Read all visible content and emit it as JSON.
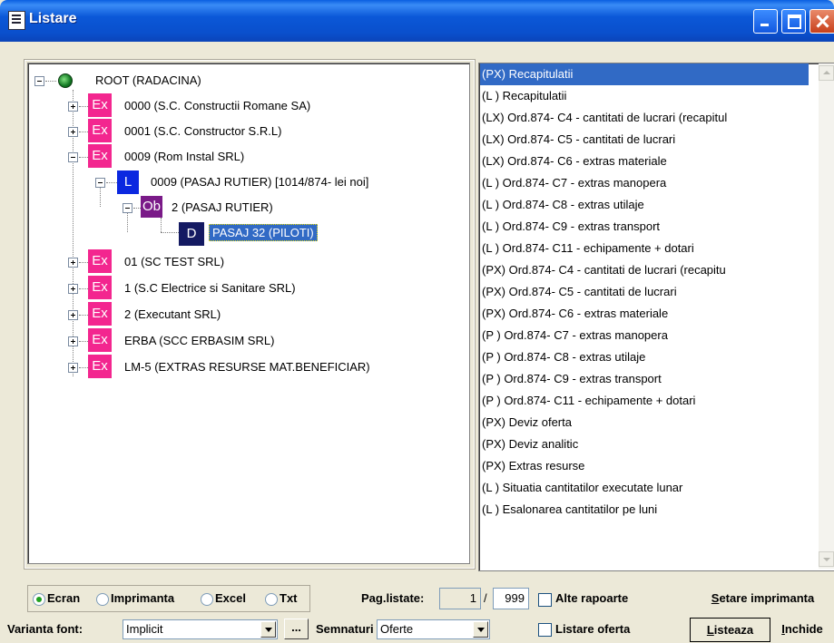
{
  "window": {
    "title": "Listare"
  },
  "tree": {
    "root": "ROOT (RADACINA)",
    "nodes": [
      {
        "badge": "Ex",
        "label": "0000 (S.C. Constructii Romane SA)"
      },
      {
        "badge": "Ex",
        "label": "0001 (S.C. Constructor S.R.L)"
      },
      {
        "badge": "Ex",
        "label": "0009 (Rom Instal SRL)"
      },
      {
        "badge": "L",
        "label": "0009 (PASAJ RUTIER) [1014/874- lei noi]"
      },
      {
        "badge": "Ob",
        "label": "2 (PASAJ RUTIER)"
      },
      {
        "badge": "D",
        "label": "PASAJ 32 (PILOTI)"
      },
      {
        "badge": "Ex",
        "label": "01 (SC TEST SRL)"
      },
      {
        "badge": "Ex",
        "label": "1 (S.C Electrice si Sanitare SRL)"
      },
      {
        "badge": "Ex",
        "label": "2 (Executant SRL)"
      },
      {
        "badge": "Ex",
        "label": "ERBA (SCC ERBASIM SRL)"
      },
      {
        "badge": "Ex",
        "label": "LM-5 (EXTRAS RESURSE MAT.BENEFICIAR)"
      }
    ],
    "colors": {
      "ex": "#f3268f",
      "l": "#0b28e0",
      "ob": "#7a1a88",
      "d": "#141a62",
      "selection": "#316ac5"
    }
  },
  "reports": {
    "items": [
      "(PX) Recapitulatii",
      "(L ) Recapitulatii",
      "(LX) Ord.874- C4 - cantitati de lucrari (recapitul",
      "(LX) Ord.874- C5 - cantitati de lucrari",
      "(LX) Ord.874- C6 - extras materiale",
      "(L ) Ord.874- C7 - extras manopera",
      "(L ) Ord.874- C8 - extras utilaje",
      "(L ) Ord.874- C9 - extras transport",
      "(L ) Ord.874- C11 - echipamente + dotari",
      "(PX) Ord.874- C4 - cantitati de lucrari (recapitu",
      "(PX) Ord.874- C5 - cantitati de lucrari",
      "(PX) Ord.874- C6 - extras materiale",
      "(P ) Ord.874- C7 - extras manopera",
      "(P ) Ord.874- C8 - extras utilaje",
      "(P ) Ord.874- C9 - extras transport",
      "(P ) Ord.874- C11 - echipamente + dotari",
      "(PX) Deviz oferta",
      "(PX) Deviz analitic",
      "(PX) Extras resurse",
      "(L ) Situatia cantitatilor executate lunar",
      "(L ) Esalonarea cantitatilor pe luni"
    ],
    "selected": "(PX) Recapitulatii"
  },
  "output": {
    "options": [
      "Ecran",
      "Imprimanta",
      "Excel",
      "Txt"
    ],
    "selected": "Ecran"
  },
  "pages": {
    "label": "Pag.listate:",
    "from": "1",
    "sep": "/",
    "to": "999"
  },
  "checks": {
    "alte_rapoarte": "Alte rapoarte",
    "listare_oferta": "Listare oferta"
  },
  "font": {
    "label": "Varianta font:",
    "value": "Implicit",
    "more": "..."
  },
  "semnaturi": {
    "label": "Semnaturi",
    "value": "Oferte"
  },
  "buttons": {
    "setare_pre": "S",
    "setare_rest": "etare imprimanta",
    "listeaza_pre": "L",
    "listeaza_rest": "isteaza",
    "inchide_pre": "I",
    "inchide_rest": "nchide"
  }
}
